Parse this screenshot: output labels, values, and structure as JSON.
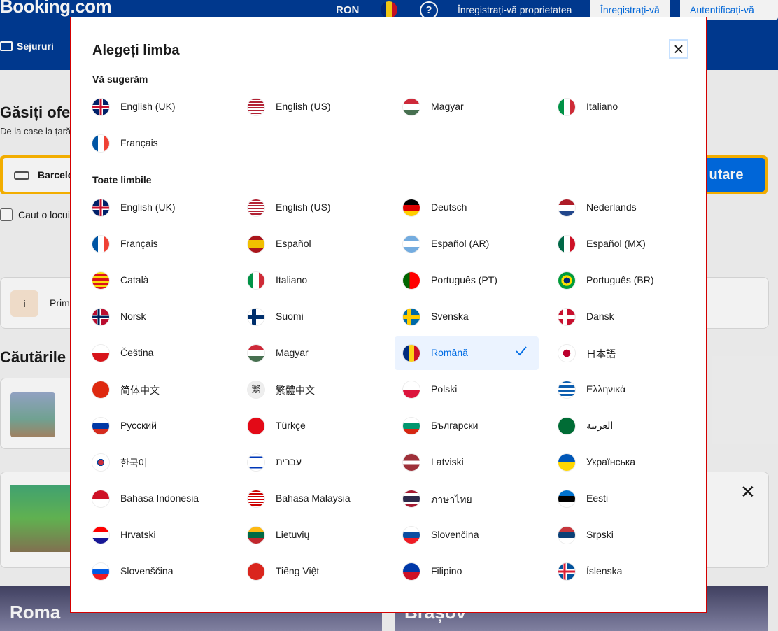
{
  "header": {
    "logo": "Booking.com",
    "currency": "RON",
    "help": "?",
    "list_property": "Înregistrați-vă proprietatea",
    "register": "Înregistrați-vă",
    "sign_in": "Autentificați-vă",
    "nav_stays": "Sejururi"
  },
  "background": {
    "title": "Găsiți ofe",
    "subtitle": "De la case la țară",
    "search_destination": "Barcelo",
    "search_button": "utare",
    "work_travel": "Caut o locui",
    "info_text": "Prim",
    "info_icon": "i",
    "recent_title": "Căutările",
    "city_left": "Roma",
    "city_right": "Brașov"
  },
  "modal": {
    "title": "Alegeți limba",
    "suggested_heading": "Vă sugerăm",
    "all_heading": "Toate limbile",
    "suggested": [
      {
        "label": "English (UK)",
        "flag": "uk"
      },
      {
        "label": "English (US)",
        "flag": "us"
      },
      {
        "label": "Magyar",
        "flag": "hu"
      },
      {
        "label": "Italiano",
        "flag": "it"
      },
      {
        "label": "Français",
        "flag": "fr"
      }
    ],
    "all": [
      {
        "label": "English (UK)",
        "flag": "uk"
      },
      {
        "label": "English (US)",
        "flag": "us"
      },
      {
        "label": "Deutsch",
        "flag": "de"
      },
      {
        "label": "Nederlands",
        "flag": "nl"
      },
      {
        "label": "Français",
        "flag": "fr"
      },
      {
        "label": "Español",
        "flag": "es"
      },
      {
        "label": "Español (AR)",
        "flag": "ar"
      },
      {
        "label": "Español (MX)",
        "flag": "mx"
      },
      {
        "label": "Català",
        "flag": "ca"
      },
      {
        "label": "Italiano",
        "flag": "it"
      },
      {
        "label": "Português (PT)",
        "flag": "pt"
      },
      {
        "label": "Português (BR)",
        "flag": "br"
      },
      {
        "label": "Norsk",
        "flag": "no"
      },
      {
        "label": "Suomi",
        "flag": "fi"
      },
      {
        "label": "Svenska",
        "flag": "se"
      },
      {
        "label": "Dansk",
        "flag": "dk"
      },
      {
        "label": "Čeština",
        "flag": "cz"
      },
      {
        "label": "Magyar",
        "flag": "hu"
      },
      {
        "label": "Română",
        "flag": "ro",
        "selected": true
      },
      {
        "label": "日本語",
        "flag": "jp"
      },
      {
        "label": "简体中文",
        "flag": "cn"
      },
      {
        "label": "繁體中文",
        "flag": "tw"
      },
      {
        "label": "Polski",
        "flag": "pl"
      },
      {
        "label": "Ελληνικά",
        "flag": "gr"
      },
      {
        "label": "Русский",
        "flag": "ru"
      },
      {
        "label": "Türkçe",
        "flag": "tr"
      },
      {
        "label": "Български",
        "flag": "bg"
      },
      {
        "label": "العربية",
        "flag": "sa"
      },
      {
        "label": "한국어",
        "flag": "kr"
      },
      {
        "label": "עברית",
        "flag": "il"
      },
      {
        "label": "Latviski",
        "flag": "lv"
      },
      {
        "label": "Українська",
        "flag": "ua"
      },
      {
        "label": "Bahasa Indonesia",
        "flag": "id"
      },
      {
        "label": "Bahasa Malaysia",
        "flag": "my"
      },
      {
        "label": "ภาษาไทย",
        "flag": "th"
      },
      {
        "label": "Eesti",
        "flag": "ee"
      },
      {
        "label": "Hrvatski",
        "flag": "hr"
      },
      {
        "label": "Lietuvių",
        "flag": "lt"
      },
      {
        "label": "Slovenčina",
        "flag": "sk"
      },
      {
        "label": "Srpski",
        "flag": "rs"
      },
      {
        "label": "Slovenščina",
        "flag": "si"
      },
      {
        "label": "Tiếng Việt",
        "flag": "vn"
      },
      {
        "label": "Filipino",
        "flag": "ph"
      },
      {
        "label": "Íslenska",
        "flag": "is"
      }
    ]
  },
  "colors": {
    "brand": "#003b95",
    "accent": "#006ce4",
    "search_border": "#ffb700",
    "modal_border": "#d40000",
    "selected_bg": "#ebf3ff"
  }
}
